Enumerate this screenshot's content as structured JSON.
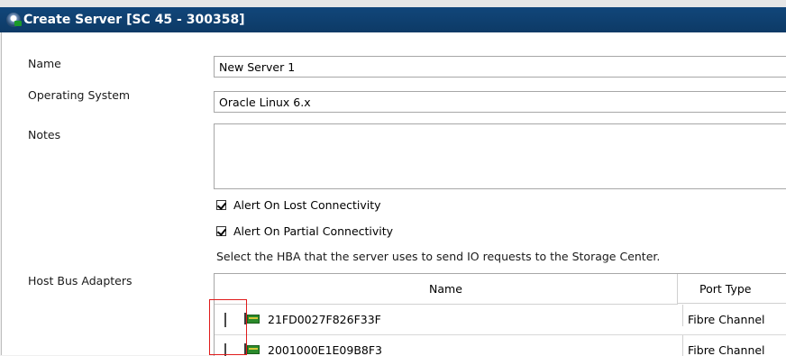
{
  "window": {
    "title": "Create Server [SC 45 - 300358]"
  },
  "form": {
    "name_label": "Name",
    "name_value": "New Server 1",
    "os_label": "Operating System",
    "os_value": "Oracle Linux 6.x",
    "notes_label": "Notes",
    "notes_value": "",
    "alert_lost": {
      "label": "Alert On Lost Connectivity",
      "checked": true
    },
    "alert_partial": {
      "label": "Alert On Partial Connectivity",
      "checked": true
    },
    "hba_hint": "Select the HBA that the server uses to send IO requests to the Storage Center.",
    "hba_label": "Host Bus Adapters"
  },
  "hba_table": {
    "columns": [
      "Name",
      "Port Type"
    ],
    "rows": [
      {
        "name": "21FD0027F826F33F",
        "port_type": "Fibre Channel",
        "checked": false
      },
      {
        "name": "2001000E1E09B8F3",
        "port_type": "Fibre Channel",
        "checked": false
      }
    ]
  },
  "colors": {
    "titlebar": "#11467a",
    "highlight": "#e01b1b",
    "hba_icon": "#2b8a2b"
  },
  "icons": {
    "app": "server-app-icon",
    "hba": "hba-card-icon"
  }
}
